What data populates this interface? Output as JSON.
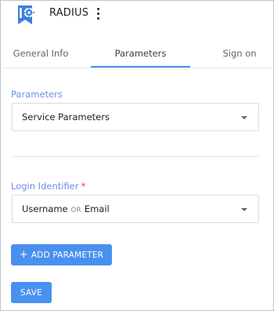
{
  "header": {
    "app_title": "RADIUS",
    "logo_icon": "radius-badge-icon",
    "menu_icon": "more-vertical-icon"
  },
  "tabs": [
    {
      "label": "General Info",
      "active": false
    },
    {
      "label": "Parameters",
      "active": true
    },
    {
      "label": "Sign on",
      "active": false
    }
  ],
  "parameters": {
    "label": "Parameters",
    "selected": "Service Parameters"
  },
  "login_identifier": {
    "label": "Login Identifier",
    "required_marker": "*",
    "value_part1": "Username",
    "value_or": "OR",
    "value_part2": "Email"
  },
  "actions": {
    "add_parameter_plus": "+",
    "add_parameter_label": "ADD PARAMETER",
    "save_label": "SAVE"
  },
  "colors": {
    "accent": "#4a90f0",
    "label_blue": "#6b8fe8",
    "required_red": "#e53935"
  }
}
